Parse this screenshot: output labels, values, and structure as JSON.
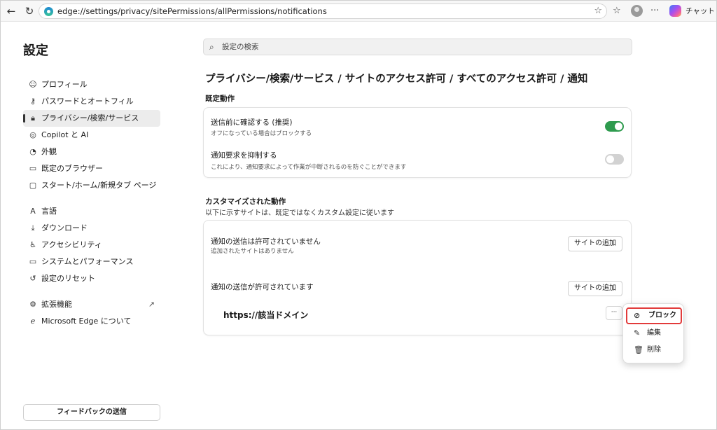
{
  "browser": {
    "url": "edge://settings/privacy/sitePermissions/allPermissions/notifications",
    "chat_label": "チャット"
  },
  "sidebar": {
    "title": "設定",
    "items": [
      {
        "label": "プロフィール",
        "icon": "profile-icon"
      },
      {
        "label": "パスワードとオートフィル",
        "icon": "key-icon"
      },
      {
        "label": "プライバシー/検索/サービス",
        "icon": "lock-icon",
        "active": true
      },
      {
        "label": "Copilot と AI",
        "icon": "copilot-icon"
      },
      {
        "label": "外観",
        "icon": "palette-icon"
      },
      {
        "label": "既定のブラウザー",
        "icon": "browser-icon"
      },
      {
        "label": "スタート/ホーム/新規タブ ページ",
        "icon": "home-tab-icon"
      },
      {
        "label": "言語",
        "icon": "language-icon"
      },
      {
        "label": "ダウンロード",
        "icon": "download-icon"
      },
      {
        "label": "アクセシビリティ",
        "icon": "accessibility-icon"
      },
      {
        "label": "システムとパフォーマンス",
        "icon": "laptop-icon"
      },
      {
        "label": "設定のリセット",
        "icon": "reset-icon"
      },
      {
        "label": "拡張機能",
        "icon": "extensions-icon"
      },
      {
        "label": "Microsoft Edge について",
        "icon": "edge-logo-icon"
      }
    ],
    "feedback_label": "フィードバックの送信"
  },
  "search": {
    "placeholder": "設定の検索"
  },
  "breadcrumb": "プライバシー/検索/サービス / サイトのアクセス許可 / すべてのアクセス許可 / 通知",
  "default_behavior": {
    "heading": "既定動作",
    "rows": [
      {
        "title": "送信前に確認する (推奨)",
        "desc": "オフになっている場合はブロックする",
        "toggle_on": true
      },
      {
        "title": "通知要求を抑制する",
        "desc": "これにより、通知要求によって作業が中断されるのを防ぐことができます",
        "toggle_on": false
      }
    ]
  },
  "custom_behavior": {
    "heading": "カスタマイズされた動作",
    "subheading": "以下に示すサイトは、既定ではなくカスタム設定に従います",
    "blocked": {
      "title": "通知の送信は許可されていません",
      "desc": "追加されたサイトはありません",
      "add_label": "サイトの追加"
    },
    "allowed": {
      "title": "通知の送信が許可されています",
      "add_label": "サイトの追加",
      "sites": [
        "https://該当ドメイン"
      ],
      "more_label": "···"
    }
  },
  "context_menu": {
    "items": [
      {
        "label": "ブロック",
        "icon": "block-icon"
      },
      {
        "label": "編集",
        "icon": "pencil-icon"
      },
      {
        "label": "削除",
        "icon": "trash-icon"
      }
    ]
  },
  "colors": {
    "toggle_on": "#2e9b4e",
    "toggle_off": "#d2d2d2",
    "highlight": "#e23b3b"
  }
}
